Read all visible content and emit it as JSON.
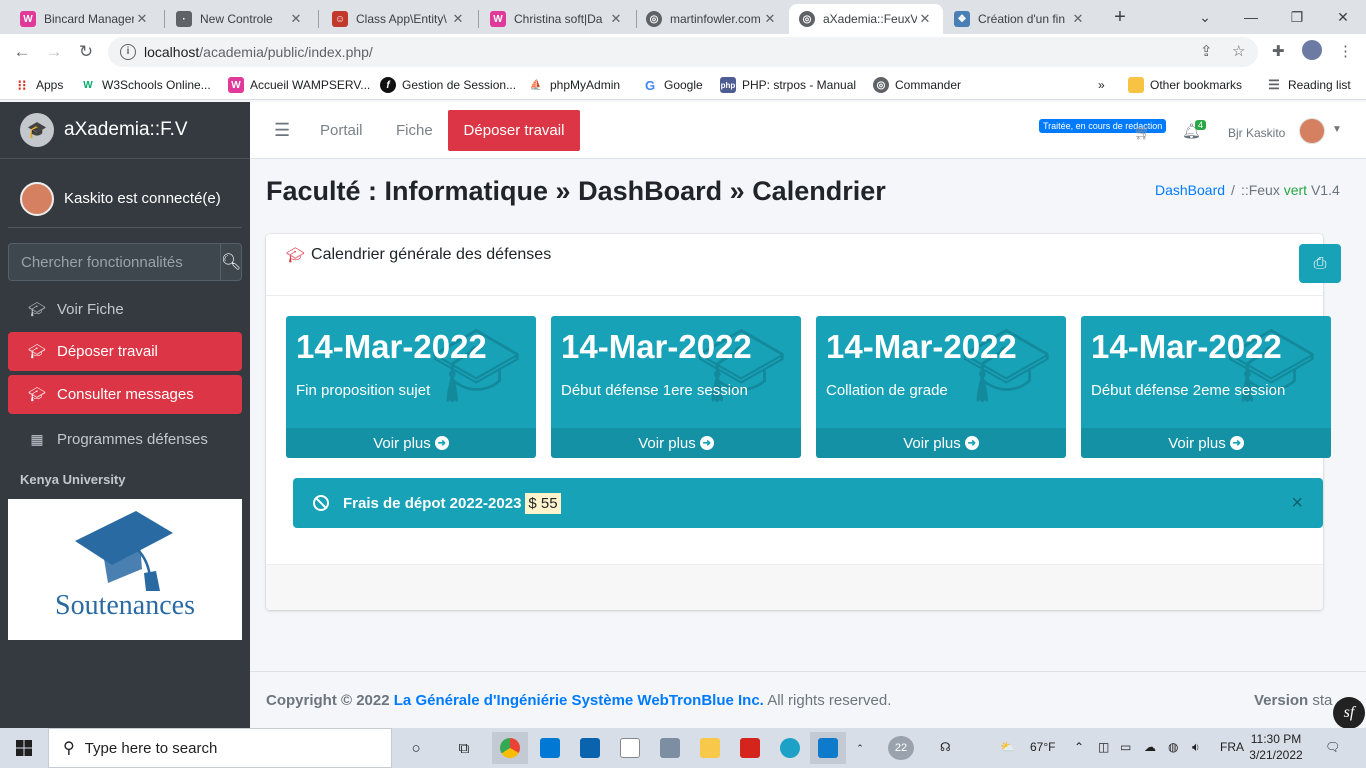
{
  "browser": {
    "tabs": [
      {
        "title": "Bincard Manager",
        "active": false
      },
      {
        "title": "New Controle",
        "active": false
      },
      {
        "title": "Class App\\Entity\\",
        "active": false
      },
      {
        "title": "Christina soft|Da",
        "active": false
      },
      {
        "title": "martinfowler.com",
        "active": false
      },
      {
        "title": "aXademia::FeuxV",
        "active": true
      },
      {
        "title": "Création d'un fin",
        "active": false
      }
    ],
    "new_tab": "+",
    "url_host": "localhost",
    "url_path": "/academia/public/index.php/",
    "bookmarks": [
      "Apps",
      "W3Schools Online...",
      "Accueil WAMPSERV...",
      "Gestion de Session...",
      "phpMyAdmin",
      "Google",
      "PHP: strpos - Manual",
      "Commander"
    ],
    "bookmarks_more": "»",
    "other_bookmarks": "Other bookmarks",
    "reading_list": "Reading list"
  },
  "sidebar": {
    "brand": "aXademia::F.V",
    "user": "Kaskito est connecté(e)",
    "search_placeholder": "Chercher fonctionnalités",
    "items": [
      {
        "label": "Voir Fiche",
        "icon": "graduation-cap-icon",
        "highlight": false
      },
      {
        "label": "Déposer travail",
        "icon": "graduation-cap-icon",
        "highlight": true
      },
      {
        "label": "Consulter messages",
        "icon": "graduation-cap-icon",
        "highlight": true
      },
      {
        "label": "Programmes défenses",
        "icon": "calendar-icon",
        "highlight": false
      }
    ],
    "university": "Kenya University",
    "image_caption": "Soutenances"
  },
  "navbar": {
    "links": [
      "Portail",
      "Fiche"
    ],
    "action": "Déposer travail",
    "status_badge": "Traitée, en cours de redaction",
    "notif_count": "4",
    "greeting": "Bjr Kaskito"
  },
  "content": {
    "title_faculty": "Faculté : Informatique",
    "title_dashboard": "DashBoard",
    "title_page": "Calendrier",
    "breadcrumb_link": "DashBoard",
    "breadcrumb_sep": "/",
    "breadcrumb_prefix": "::Feux",
    "breadcrumb_green": "vert",
    "breadcrumb_version": "V1.4",
    "card_title": "Calendrier générale des défenses",
    "boxes": [
      {
        "date": "14-Mar-2022",
        "label": "Fin proposition sujet",
        "more": "Voir plus"
      },
      {
        "date": "14-Mar-2022",
        "label": "Début défense 1ere session",
        "more": "Voir plus"
      },
      {
        "date": "14-Mar-2022",
        "label": "Collation de grade",
        "more": "Voir plus"
      },
      {
        "date": "14-Mar-2022",
        "label": "Début défense 2eme session",
        "more": "Voir plus"
      }
    ],
    "alert_text": "Frais de dépot 2022-2023",
    "alert_amount": "$ 55",
    "alert_close": "×"
  },
  "footer": {
    "copyright": "Copyright © 2022",
    "organization": "La Générale d'Ingéniérie Système WebTronBlue Inc.",
    "rights": "All rights reserved.",
    "version_label": "Version",
    "version_value": "sta"
  },
  "taskbar": {
    "search_placeholder": "Type here to search",
    "badge": "22",
    "weather": "67°F",
    "lang": "FRA",
    "time": "11:30 PM",
    "date": "3/21/2022"
  },
  "colors": {
    "danger": "#dc3545",
    "info": "#17a2b8",
    "sidebar": "#343a40",
    "primary": "#007bff"
  }
}
